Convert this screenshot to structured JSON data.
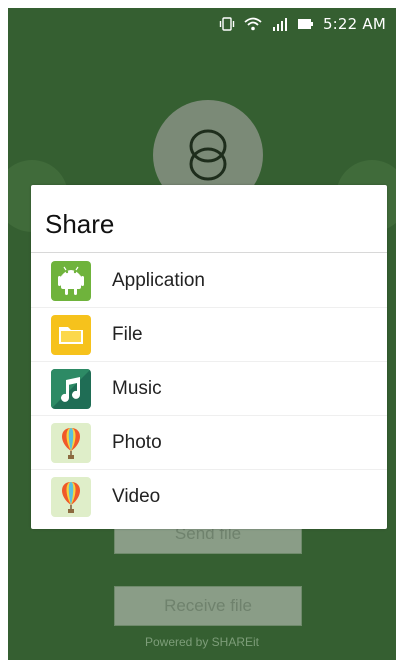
{
  "status": {
    "time": "5:22 AM"
  },
  "dialog": {
    "title": "Share",
    "options": [
      {
        "label": "Application",
        "icon": "android-icon"
      },
      {
        "label": "File",
        "icon": "folder-icon"
      },
      {
        "label": "Music",
        "icon": "music-icon"
      },
      {
        "label": "Photo",
        "icon": "photo-icon"
      },
      {
        "label": "Video",
        "icon": "video-icon"
      }
    ]
  },
  "buttons": {
    "send": "Send file",
    "receive": "Receive file"
  },
  "footer": {
    "powered_by": "Powered by SHAREit"
  },
  "colors": {
    "background_green": "#355f31",
    "dialog_white": "#ffffff",
    "button_gray": "#8a9d87"
  }
}
